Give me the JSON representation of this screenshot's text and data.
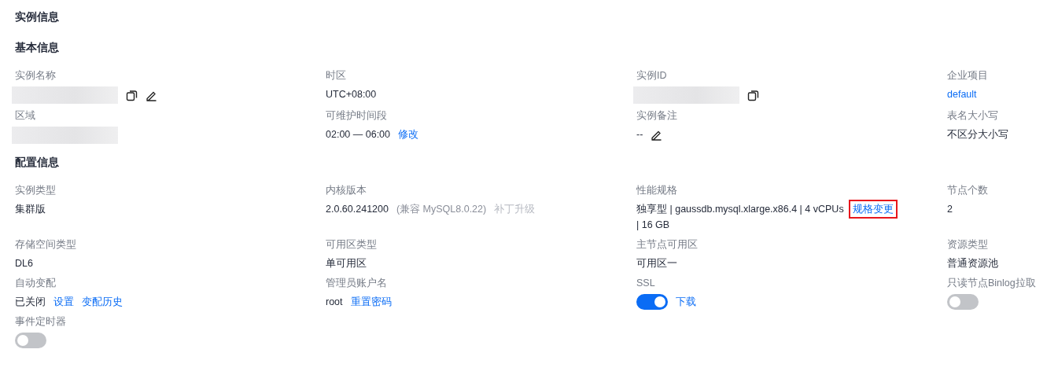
{
  "title": "实例信息",
  "sections": [
    {
      "heading": "基本信息",
      "fields": [
        {
          "label": "实例名称",
          "value": [
            {
              "kind": "redacted"
            },
            {
              "kind": "copy"
            },
            {
              "kind": "edit"
            }
          ]
        },
        {
          "label": "时区",
          "value": [
            {
              "kind": "text",
              "text": "UTC+08:00"
            }
          ]
        },
        {
          "label": "实例ID",
          "value": [
            {
              "kind": "redacted"
            },
            {
              "kind": "copy"
            }
          ]
        },
        {
          "label": "企业项目",
          "value": [
            {
              "kind": "link",
              "text": "default"
            }
          ]
        },
        {
          "label": "区域",
          "value": [
            {
              "kind": "redacted"
            }
          ]
        },
        {
          "label": "可维护时间段",
          "value": [
            {
              "kind": "text",
              "text": "02:00 — 06:00"
            },
            {
              "kind": "link",
              "text": "修改"
            }
          ]
        },
        {
          "label": "实例备注",
          "value": [
            {
              "kind": "text",
              "text": "--"
            },
            {
              "kind": "edit"
            }
          ]
        },
        {
          "label": "表名大小写",
          "value": [
            {
              "kind": "text",
              "text": "不区分大小写"
            }
          ]
        }
      ]
    },
    {
      "heading": "配置信息",
      "fields": [
        {
          "label": "实例类型",
          "value": [
            {
              "kind": "text",
              "text": "集群版"
            }
          ]
        },
        {
          "label": "内核版本",
          "value": [
            {
              "kind": "text",
              "text": "2.0.60.241200"
            },
            {
              "kind": "muted",
              "text": "(兼容 MySQL8.0.22)"
            },
            {
              "kind": "disabled-link",
              "text": "补丁升级"
            }
          ]
        },
        {
          "label": "性能规格",
          "value": [
            {
              "kind": "text",
              "text": "独享型 | gaussdb.mysql.xlarge.x86.4 | 4 vCPUs"
            },
            {
              "kind": "link",
              "text": "规格变更",
              "highlighted": true
            },
            {
              "kind": "line",
              "text": "| 16 GB"
            }
          ]
        },
        {
          "label": "节点个数",
          "value": [
            {
              "kind": "text",
              "text": "2"
            }
          ]
        },
        {
          "label": "存储空间类型",
          "value": [
            {
              "kind": "text",
              "text": "DL6"
            }
          ]
        },
        {
          "label": "可用区类型",
          "value": [
            {
              "kind": "text",
              "text": "单可用区"
            }
          ]
        },
        {
          "label": "主节点可用区",
          "value": [
            {
              "kind": "text",
              "text": "可用区一"
            }
          ]
        },
        {
          "label": "资源类型",
          "value": [
            {
              "kind": "text",
              "text": "普通资源池"
            }
          ]
        },
        {
          "label": "自动变配",
          "value": [
            {
              "kind": "text",
              "text": "已关闭"
            },
            {
              "kind": "link",
              "text": "设置"
            },
            {
              "kind": "link",
              "text": "变配历史"
            }
          ]
        },
        {
          "label": "管理员账户名",
          "value": [
            {
              "kind": "text",
              "text": "root"
            },
            {
              "kind": "link",
              "text": "重置密码"
            }
          ]
        },
        {
          "label": "SSL",
          "value": [
            {
              "kind": "toggle",
              "on": true
            },
            {
              "kind": "link",
              "text": "下载"
            }
          ]
        },
        {
          "label": "只读节点Binlog拉取",
          "value": [
            {
              "kind": "toggle",
              "on": false
            }
          ]
        },
        {
          "label": "事件定时器",
          "value": [
            {
              "kind": "toggle",
              "on": false
            }
          ]
        }
      ]
    }
  ]
}
